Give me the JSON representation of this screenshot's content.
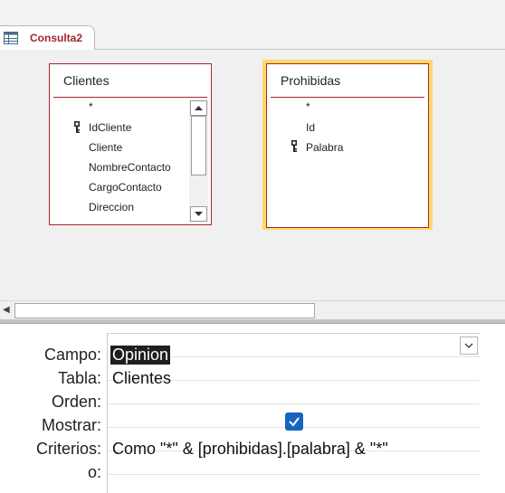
{
  "tab": {
    "label": "Consulta2",
    "icon": "query-grid-icon"
  },
  "tables": {
    "clientes": {
      "title": "Clientes",
      "fields": [
        "*",
        "IdCliente",
        "Cliente",
        "NombreContacto",
        "CargoContacto",
        "Direccion"
      ],
      "key_field": "IdCliente"
    },
    "prohibidas": {
      "title": "Prohibidas",
      "fields": [
        "*",
        "Id",
        "Palabra"
      ],
      "key_field": "Palabra"
    }
  },
  "grid": {
    "row_labels": {
      "campo": "Campo:",
      "tabla": "Tabla:",
      "orden": "Orden:",
      "mostrar": "Mostrar:",
      "criterios": "Criterios:",
      "o": "o:"
    },
    "column1": {
      "campo": "Opinion",
      "tabla": "Clientes",
      "orden": "",
      "mostrar": true,
      "criterios": "Como \"*\" & [prohibidas].[palabra] & \"*\"",
      "o": ""
    }
  },
  "colors": {
    "accent": "#a4262c",
    "selection_highlight": "#ffd966",
    "checkbox": "#1664c0"
  }
}
